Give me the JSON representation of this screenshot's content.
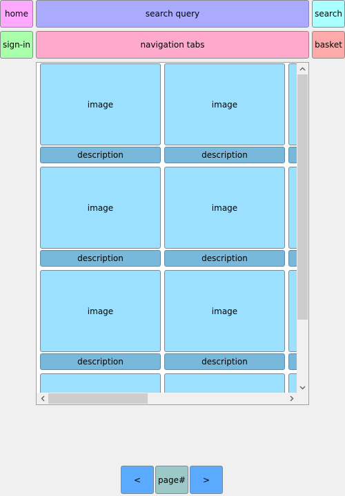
{
  "header": {
    "home_label": "home",
    "search_query_label": "search query",
    "search_label": "search",
    "signin_label": "sign-in",
    "navigation_tabs_label": "navigation tabs",
    "basket_label": "basket"
  },
  "grid": {
    "image_label": "image",
    "description_label": "description"
  },
  "pagination": {
    "prev_label": "<",
    "page_label": "page#",
    "next_label": ">"
  },
  "scrollbars": {
    "vertical_up_icon": "chevron-up-icon",
    "vertical_down_icon": "chevron-down-icon",
    "horizontal_left_icon": "chevron-left-icon",
    "horizontal_right_icon": "chevron-right-icon"
  },
  "colors": {
    "home": "#ffa8ff",
    "search_query": "#aaaaff",
    "search": "#aaffff",
    "signin": "#aaffaa",
    "navigation_tabs": "#ffaacc",
    "basket": "#ffaaaa",
    "image": "#9be0ff",
    "description": "#78b8da",
    "page_nav_button": "#5aaaff",
    "page_number": "#9cc8c8"
  }
}
